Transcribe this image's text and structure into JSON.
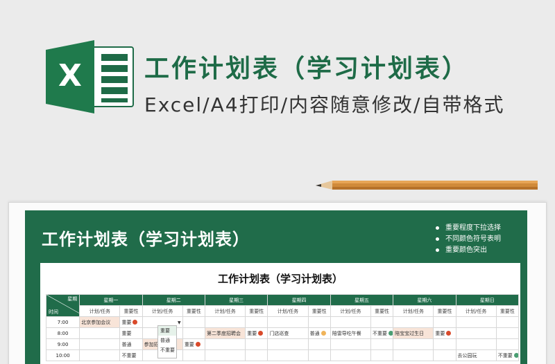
{
  "banner": {
    "logo_letter": "X",
    "title": "工作计划表（学习计划表）",
    "subtitle": "Excel/A4打印/内容随意修改/自带格式"
  },
  "sheet": {
    "header_title": "工作计划表（学习计划表）",
    "notes": [
      "重要程度下拉选择",
      "不同颜色符号表明",
      "重要颜色突出"
    ],
    "table_title": "工作计划表（学习计划表）",
    "corner_top": "星期",
    "corner_bottom": "时间",
    "days": [
      "星期一",
      "星期二",
      "星期三",
      "星期四",
      "星期五",
      "星期六",
      "星期日"
    ],
    "sub_task": "计划/任务",
    "sub_imp": "重要性",
    "rows": [
      {
        "time": "7:00",
        "cells": [
          {
            "task": "北京参加会议",
            "imp": "重要",
            "dot": "#d94a2b",
            "fill": true
          },
          {
            "task": "",
            "imp": "",
            "dot": ""
          },
          {
            "task": "",
            "imp": "",
            "dot": ""
          },
          {
            "task": "",
            "imp": "",
            "dot": ""
          },
          {
            "task": "",
            "imp": "",
            "dot": ""
          },
          {
            "task": "",
            "imp": "",
            "dot": ""
          },
          {
            "task": "",
            "imp": "",
            "dot": ""
          }
        ]
      },
      {
        "time": "8:00",
        "cells": [
          {
            "task": "",
            "imp": "重要",
            "dot": ""
          },
          {
            "task": "",
            "imp": "",
            "dot": ""
          },
          {
            "task": "第二季度招聘会",
            "imp": "重要",
            "dot": "#d94a2b",
            "fill": true
          },
          {
            "task": "门店巡查",
            "imp": "普通",
            "dot": "#f0b45a"
          },
          {
            "task": "陪雷导吃午餐",
            "imp": "不重要",
            "dot": "#4a9e72"
          },
          {
            "task": "陪宝宝过生日",
            "imp": "重要",
            "dot": "#d94a2b",
            "fill": true
          },
          {
            "task": "",
            "imp": "",
            "dot": ""
          }
        ]
      },
      {
        "time": "9:00",
        "cells": [
          {
            "task": "",
            "imp": "普通",
            "dot": ""
          },
          {
            "task": "参加招标会",
            "imp": "重要",
            "dot": "#d94a2b",
            "fill": true
          },
          {
            "task": "",
            "imp": "",
            "dot": ""
          },
          {
            "task": "",
            "imp": "",
            "dot": ""
          },
          {
            "task": "",
            "imp": "",
            "dot": ""
          },
          {
            "task": "",
            "imp": "",
            "dot": ""
          },
          {
            "task": "",
            "imp": "",
            "dot": ""
          }
        ]
      },
      {
        "time": "10:00",
        "cells": [
          {
            "task": "",
            "imp": "不重要",
            "dot": ""
          },
          {
            "task": "",
            "imp": "",
            "dot": ""
          },
          {
            "task": "",
            "imp": "",
            "dot": ""
          },
          {
            "task": "",
            "imp": "",
            "dot": ""
          },
          {
            "task": "",
            "imp": "",
            "dot": ""
          },
          {
            "task": "",
            "imp": "",
            "dot": ""
          },
          {
            "task": "去公园玩",
            "imp": "不重要",
            "dot": "#4a9e72"
          }
        ]
      }
    ],
    "dropdown_options": [
      "重要",
      "普通",
      "不重要"
    ]
  },
  "colors": {
    "brand_green": "#206c4a",
    "important": "#d94a2b",
    "normal": "#f0b45a",
    "unimportant": "#4a9e72",
    "highlight_fill": "#f8e4d8"
  }
}
